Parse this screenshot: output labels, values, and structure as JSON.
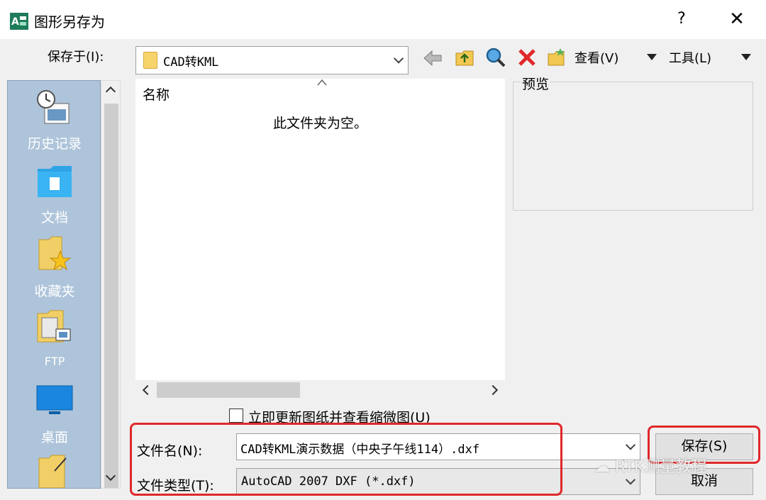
{
  "window": {
    "title": "图形另存为",
    "help_label": "?",
    "close_label": "✕"
  },
  "save_in": {
    "label": "保存于(I):",
    "value": "CAD转KML"
  },
  "toolbar": {
    "back_icon": "back-arrow-icon",
    "up_folder_icon": "up-folder-icon",
    "search_icon": "search-web-icon",
    "delete_icon": "delete-icon",
    "new_folder_icon": "new-folder-icon",
    "view_label": "查看(V)",
    "tools_label": "工具(L)"
  },
  "places": [
    {
      "label": "历史记录",
      "icon": "history-icon"
    },
    {
      "label": "文档",
      "icon": "documents-icon"
    },
    {
      "label": "收藏夹",
      "icon": "favorites-icon"
    },
    {
      "label": "FTP",
      "icon": "ftp-icon"
    },
    {
      "label": "桌面",
      "icon": "desktop-icon"
    }
  ],
  "file_list": {
    "column_header": "名称",
    "empty_message": "此文件夹为空。"
  },
  "preview": {
    "label": "预览"
  },
  "update_thumbnail": {
    "label": "立即更新图纸并查看缩微图(U)",
    "checked": false
  },
  "file_name": {
    "label": "文件名(N):",
    "value": "CAD转KML演示数据（中央子午线114）.dxf"
  },
  "file_type": {
    "label": "文件类型(T):",
    "value": "AutoCAD 2007 DXF (*.dxf)"
  },
  "buttons": {
    "save_label": "保存(S)",
    "cancel_label": "取消"
  },
  "watermark": {
    "text": "RTK测量教程"
  },
  "colors": {
    "highlight": "#e0282a",
    "places_bg": "#aec4da"
  }
}
